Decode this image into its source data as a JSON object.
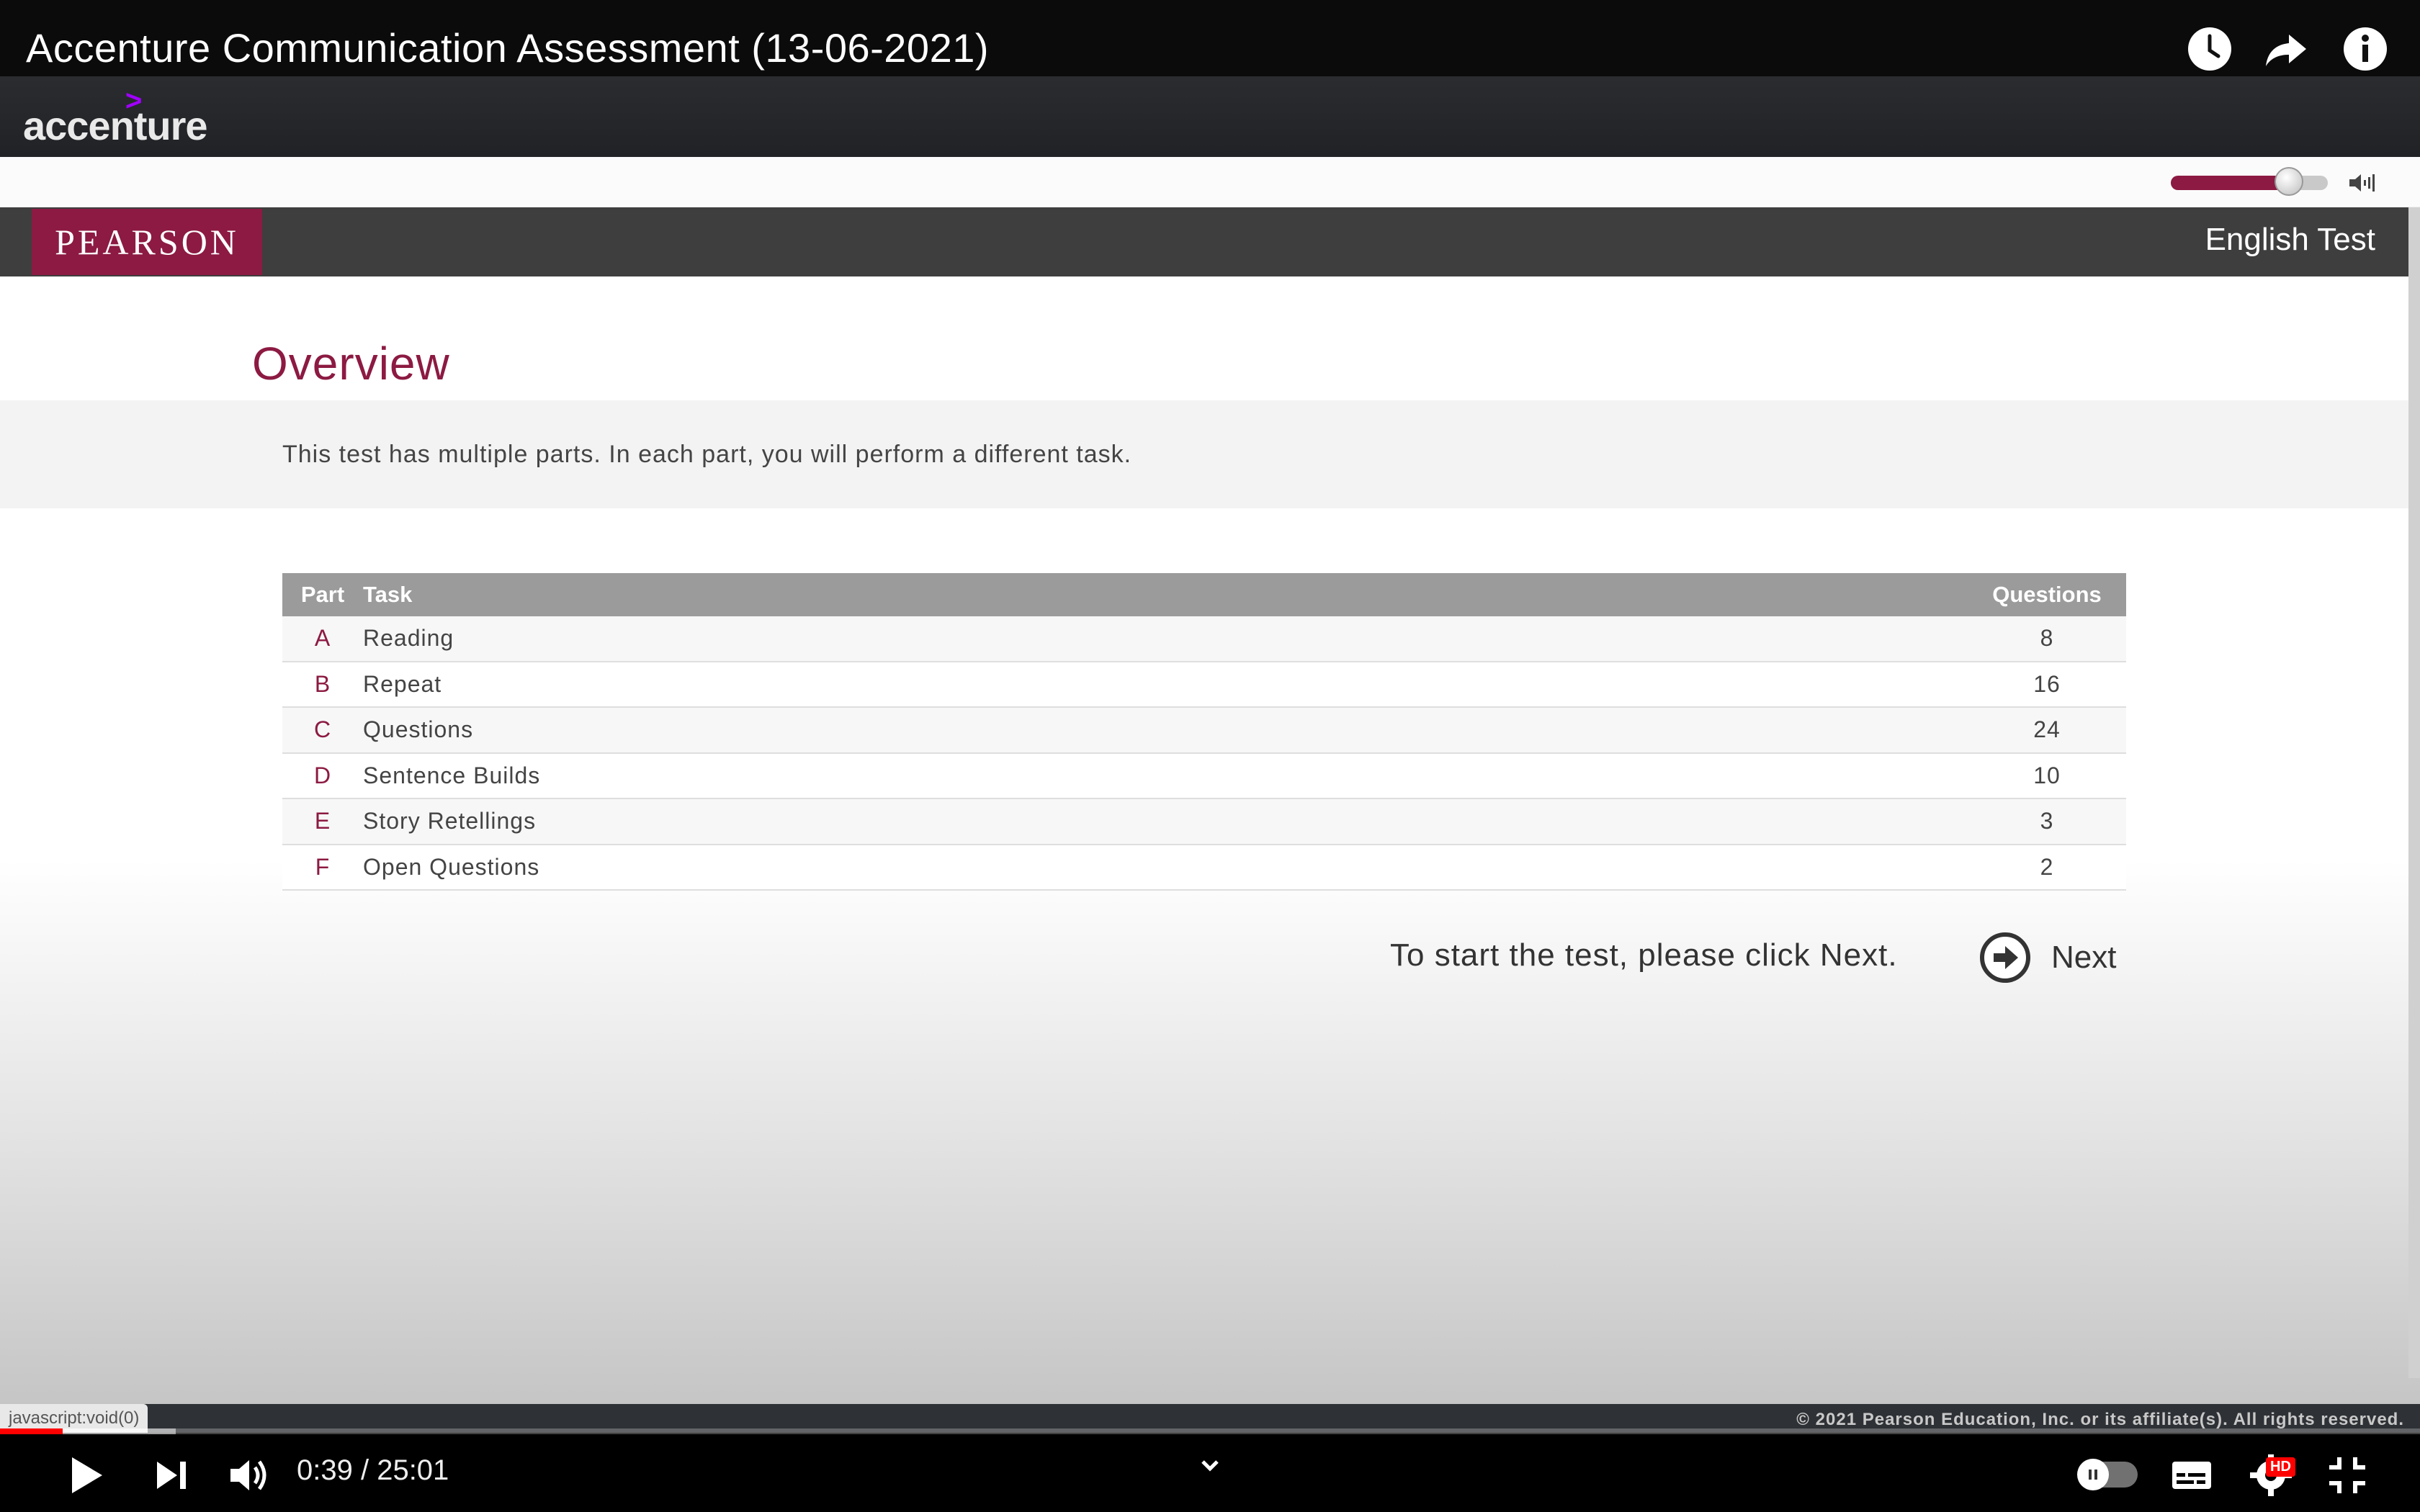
{
  "video": {
    "title": "Accenture Communication Assessment (13-06-2021)",
    "time_current": "0:39",
    "time_separator": " / ",
    "time_total": "25:01",
    "progress_fraction": 0.026,
    "hd_label": "HD"
  },
  "top_icons": [
    "watch-later-icon",
    "share-icon",
    "info-icon"
  ],
  "brand": {
    "accenture": "accenture",
    "pearson": "PEARSON",
    "product": "English Test"
  },
  "overview": {
    "title": "Overview",
    "intro": "This test has multiple parts. In each part, you will perform a different task."
  },
  "table": {
    "headers": {
      "part": "Part",
      "task": "Task",
      "questions": "Questions"
    },
    "rows": [
      {
        "part": "A",
        "task": "Reading",
        "questions": "8"
      },
      {
        "part": "B",
        "task": "Repeat",
        "questions": "16"
      },
      {
        "part": "C",
        "task": "Questions",
        "questions": "24"
      },
      {
        "part": "D",
        "task": "Sentence Builds",
        "questions": "10"
      },
      {
        "part": "E",
        "task": "Story Retellings",
        "questions": "3"
      },
      {
        "part": "F",
        "task": "Open Questions",
        "questions": "2"
      }
    ]
  },
  "start": {
    "instruction": "To start the test, please click Next.",
    "next_label": "Next"
  },
  "footer": {
    "copyright": "© 2021 Pearson Education, Inc. or its affiliate(s). All rights reserved.",
    "status_url": "javascript:void(0)"
  },
  "volume_fraction": 0.75,
  "colors": {
    "brand": "#8c1a42",
    "yt_red": "#ff0000"
  }
}
